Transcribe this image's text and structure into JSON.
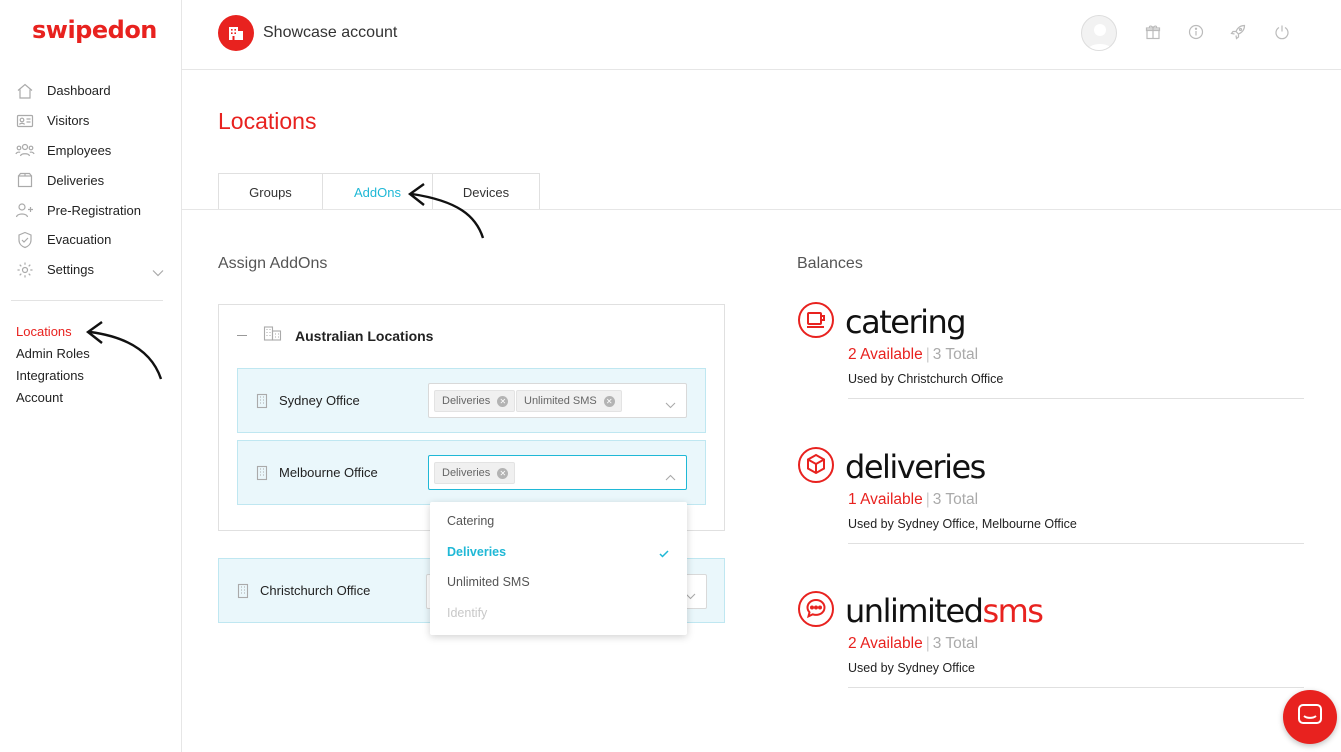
{
  "brand": {
    "logo_text": "swipedon",
    "accent": "#e8221f",
    "highlight": "#1fb8d6"
  },
  "header": {
    "account_name": "Showcase account"
  },
  "sidebar": {
    "items": [
      {
        "label": "Dashboard",
        "icon": "home-icon"
      },
      {
        "label": "Visitors",
        "icon": "visitor-card-icon"
      },
      {
        "label": "Employees",
        "icon": "employees-icon"
      },
      {
        "label": "Deliveries",
        "icon": "box-icon"
      },
      {
        "label": "Pre-Registration",
        "icon": "add-user-icon"
      },
      {
        "label": "Evacuation",
        "icon": "shield-icon"
      },
      {
        "label": "Settings",
        "icon": "gear-icon"
      }
    ],
    "sub_items": [
      {
        "label": "Locations",
        "active": true
      },
      {
        "label": "Admin Roles"
      },
      {
        "label": "Integrations"
      },
      {
        "label": "Account"
      }
    ]
  },
  "page": {
    "title": "Locations",
    "tabs": [
      {
        "label": "Groups"
      },
      {
        "label": "AddOns",
        "active": true
      },
      {
        "label": "Devices"
      }
    ]
  },
  "assign": {
    "title": "Assign AddOns",
    "group_name": "Australian Locations",
    "locations": [
      {
        "name": "Sydney Office",
        "chips": [
          "Deliveries",
          "Unlimited SMS"
        ]
      },
      {
        "name": "Melbourne Office",
        "chips": [
          "Deliveries"
        ]
      }
    ],
    "standalone": {
      "name": "Christchurch Office"
    },
    "dropdown": [
      {
        "label": "Catering"
      },
      {
        "label": "Deliveries",
        "selected": true
      },
      {
        "label": "Unlimited SMS"
      },
      {
        "label": "Identify",
        "disabled": true
      }
    ]
  },
  "balances": {
    "title": "Balances",
    "items": [
      {
        "name": "catering",
        "available": "2 Available",
        "sep": "|",
        "total": "3 Total",
        "used_by": "Used by Christchurch Office"
      },
      {
        "name": "deliveries",
        "available": "1 Available",
        "sep": "|",
        "total": "3 Total",
        "used_by": "Used by Sydney Office, Melbourne Office"
      },
      {
        "name_main": "unlimited",
        "name_hl": "sms",
        "available": "2 Available",
        "sep": "|",
        "total": "3 Total",
        "used_by": "Used by Sydney Office"
      }
    ]
  }
}
